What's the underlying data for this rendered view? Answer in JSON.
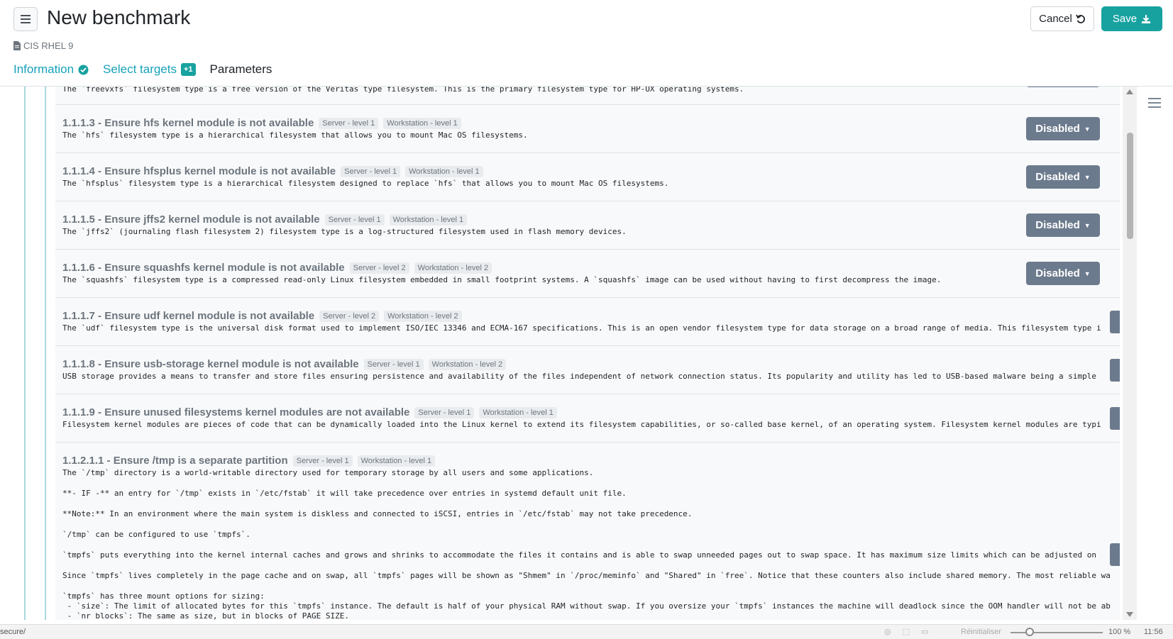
{
  "header": {
    "title": "New benchmark",
    "cancel_label": "Cancel",
    "save_label": "Save",
    "subtitle": "CIS RHEL 9"
  },
  "tabs": [
    {
      "label": "Information",
      "state": "done"
    },
    {
      "label": "Select targets",
      "badge": "+1"
    },
    {
      "label": "Parameters"
    }
  ],
  "rules": [
    {
      "title": "",
      "desc": "The `freevxfs` filesystem type is a free version of the Veritas type filesystem. This is the primary filesystem type for HP-UX operating systems."
    },
    {
      "title": "1.1.1.3 - Ensure hfs kernel module is not available",
      "server": "Server - level 1",
      "workstation": "Workstation - level 1",
      "desc": "The `hfs` filesystem type is a hierarchical filesystem that allows you to mount Mac OS filesystems.",
      "status": "Disabled"
    },
    {
      "title": "1.1.1.4 - Ensure hfsplus kernel module is not available",
      "server": "Server - level 1",
      "workstation": "Workstation - level 1",
      "desc": "The `hfsplus` filesystem type is a hierarchical filesystem designed to replace `hfs` that allows you to mount Mac OS filesystems.",
      "status": "Disabled"
    },
    {
      "title": "1.1.1.5 - Ensure jffs2 kernel module is not available",
      "server": "Server - level 1",
      "workstation": "Workstation - level 1",
      "desc": "The `jffs2` (journaling flash filesystem 2) filesystem type is a log-structured filesystem used in flash memory devices.",
      "status": "Disabled"
    },
    {
      "title": "1.1.1.6 - Ensure squashfs kernel module is not available",
      "server": "Server - level 2",
      "workstation": "Workstation - level 2",
      "desc": "The `squashfs` filesystem type is a compressed read-only Linux filesystem embedded in small footprint systems. A `squashfs` image can be used without having to first decompress the image.",
      "status": "Disabled"
    },
    {
      "title": "1.1.1.7 - Ensure udf kernel module is not available",
      "server": "Server - level 2",
      "workstation": "Workstation - level 2",
      "desc": "The `udf` filesystem type is the universal disk format used to implement ISO/IEC 13346 and ECMA-167 specifications. This is an open vendor filesystem type for data storage on a broad range of media. This filesystem type i"
    },
    {
      "title": "1.1.1.8 - Ensure usb-storage kernel module is not available",
      "server": "Server - level 1",
      "workstation": "Workstation - level 2",
      "desc": "USB storage provides a means to transfer and store files ensuring persistence and availability of the files independent of network connection status. Its popularity and utility has led to USB-based malware being a simple"
    },
    {
      "title": "1.1.1.9 - Ensure unused filesystems kernel modules are not available",
      "server": "Server - level 1",
      "workstation": "Workstation - level 1",
      "desc": "Filesystem kernel modules are pieces of code that can be dynamically loaded into the Linux kernel to extend its filesystem capabilities, or so-called base kernel, of an operating system. Filesystem kernel modules are typi"
    }
  ],
  "tmp_rule": {
    "title": "1.1.2.1.1 - Ensure /tmp is a separate partition",
    "server": "Server - level 1",
    "workstation": "Workstation - level 1",
    "paragraphs": [
      "The `/tmp` directory is a world-writable directory used for temporary storage by all users and some applications.",
      "**- IF -** an entry for `/tmp` exists in `/etc/fstab` it will take precedence over entries in systemd default unit file.",
      "**Note:** In an environment where the main system is diskless and connected to iSCSI, entries in `/etc/fstab` may not take precedence.",
      "`/tmp` can be configured to use `tmpfs`.",
      "`tmpfs` puts everything into the kernel internal caches and grows and shrinks to accommodate the files it contains and is able to swap unneeded pages out to swap space. It has maximum size limits which can be adjusted on",
      "Since `tmpfs` lives completely in the page cache and on swap, all `tmpfs` pages will be shown as \"Shmem\" in `/proc/meminfo` and \"Shared\" in `free`. Notice that these counters also include shared memory. The most reliable wa",
      "`tmpfs` has three mount options for sizing:",
      " - `size`: The limit of allocated bytes for this `tmpfs` instance. The default is half of your physical RAM without swap. If you oversize your `tmpfs` instances the machine will deadlock since the OOM handler will not be ab",
      " - `nr_blocks`: The same as size, but in blocks of PAGE_SIZE."
    ]
  },
  "statusbar": {
    "url": "secure/",
    "reset_label": "Réinitialiser",
    "zoom": "100 %",
    "time": "11:56"
  },
  "colors": {
    "accent": "#17a2a0",
    "status_button": "#6c7a8d",
    "link": "#17a2b8"
  }
}
